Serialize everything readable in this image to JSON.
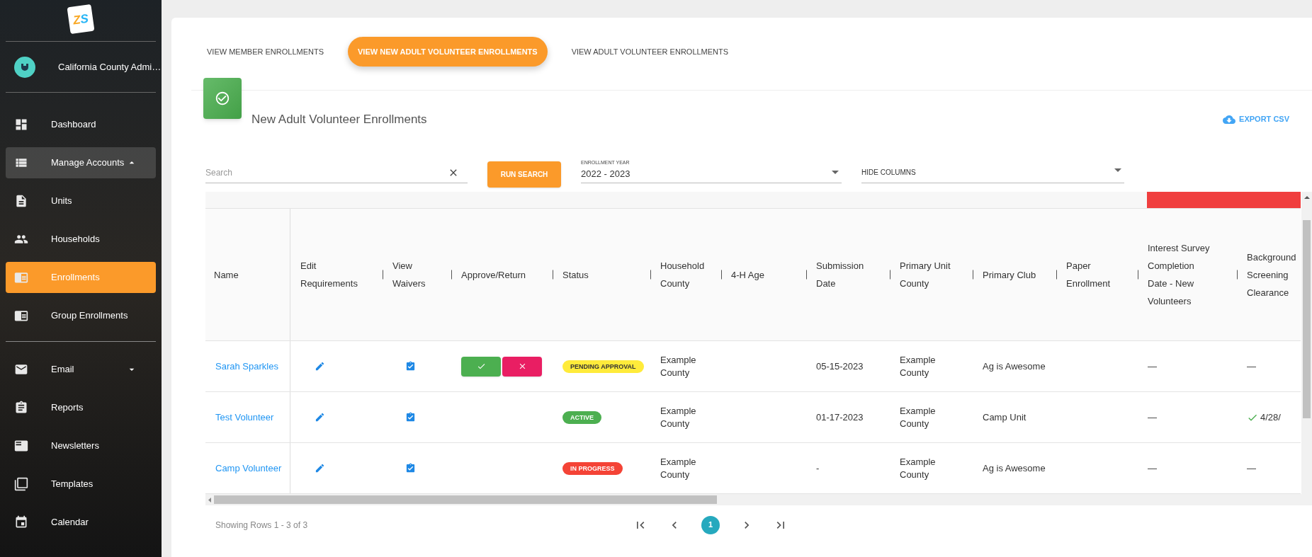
{
  "sidebar": {
    "logo_text": "ZS",
    "user": "California County Admi…",
    "groups": [
      [
        {
          "label": "Dashboard",
          "selected": false
        },
        {
          "label": "Manage Accounts",
          "selected": false,
          "expanded": true
        },
        {
          "label": "Units",
          "selected": false
        },
        {
          "label": "Households",
          "selected": false
        },
        {
          "label": "Enrollments",
          "selected": true
        },
        {
          "label": "Group Enrollments",
          "selected": false
        }
      ],
      [
        {
          "label": "Email",
          "selected": false,
          "expanded": false
        },
        {
          "label": "Reports",
          "selected": false
        },
        {
          "label": "Newsletters",
          "selected": false
        },
        {
          "label": "Templates",
          "selected": false
        },
        {
          "label": "Calendar",
          "selected": false
        }
      ]
    ]
  },
  "tabs": [
    {
      "label": "VIEW MEMBER ENROLLMENTS",
      "selected": false
    },
    {
      "label": "VIEW NEW ADULT VOLUNTEER ENROLLMENTS",
      "selected": true
    },
    {
      "label": "VIEW ADULT VOLUNTEER ENROLLMENTS",
      "selected": false
    }
  ],
  "header": {
    "title": "New Adult Volunteer Enrollments",
    "export": "EXPORT CSV"
  },
  "filters": {
    "search": {
      "placeholder": "Search"
    },
    "run_button": "RUN SEARCH",
    "year": {
      "label": "ENROLLMENT YEAR",
      "value": "2022 - 2023"
    },
    "hide_columns": {
      "value": "HIDE COLUMNS"
    }
  },
  "table": {
    "columns": [
      "Name",
      "Edit Requirements",
      "View Waivers",
      "Approve/Return",
      "Status",
      "Household County",
      "4-H Age",
      "Submission Date",
      "Primary Unit County",
      "Primary Club",
      "Paper Enrollment",
      "Interest Survey Completion Date - New Volunteers",
      "Background Screening Clearance"
    ],
    "rows": [
      {
        "name": "Sarah Sparkles",
        "approvable": true,
        "status": {
          "label": "PENDING APPROVAL",
          "color": "#ffeb3b"
        },
        "household_county": "Example County",
        "age": "",
        "submission_date": "05-15-2023",
        "primary_unit_county": "Example County",
        "primary_club": "Ag is Awesome",
        "paper_enrollment": "",
        "interest_survey": "—",
        "background": {
          "cleared": false,
          "text": "—"
        }
      },
      {
        "name": "Test Volunteer",
        "approvable": false,
        "status": {
          "label": "ACTIVE",
          "color": "#4caf50"
        },
        "household_county": "Example County",
        "age": "",
        "submission_date": "01-17-2023",
        "primary_unit_county": "Example County",
        "primary_club": "Camp Unit",
        "paper_enrollment": "",
        "interest_survey": "—",
        "background": {
          "cleared": true,
          "text": "4/28/"
        }
      },
      {
        "name": "Camp Volunteer",
        "approvable": false,
        "status": {
          "label": "IN PROGRESS",
          "color": "#f44336"
        },
        "household_county": "Example County",
        "age": "",
        "submission_date": "-",
        "primary_unit_county": "Example County",
        "primary_club": "Ag is Awesome",
        "paper_enrollment": "",
        "interest_survey": "—",
        "background": {
          "cleared": false,
          "text": "—"
        }
      }
    ]
  },
  "footer": {
    "summary": "Showing Rows 1 - 3 of 3",
    "pages": [
      {
        "label": "1",
        "selected": true
      }
    ]
  }
}
